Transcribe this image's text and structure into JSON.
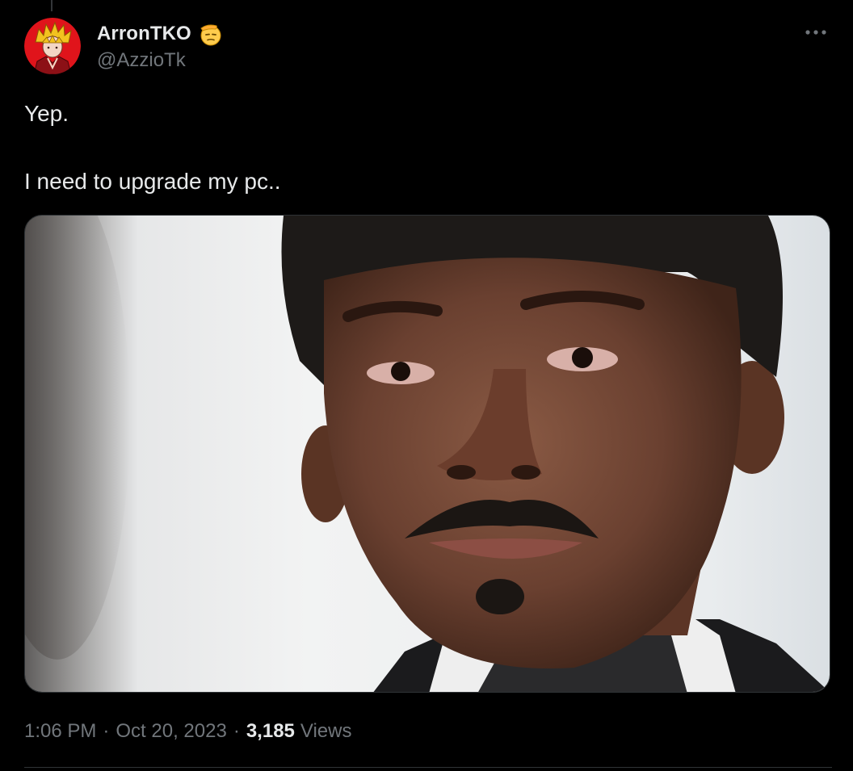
{
  "tweet": {
    "author": {
      "display_name": "ArronTKO",
      "handle": "@AzzioTk",
      "name_emoji": "saluting-face-emoji"
    },
    "more_icon": "more-horizontal-icon",
    "text_lines": [
      "Yep.",
      "I need to upgrade my pc.."
    ],
    "media": {
      "type": "photo"
    },
    "timestamp": {
      "time": "1:06 PM",
      "separator": "·",
      "date": "Oct 20, 2023"
    },
    "views": {
      "count": "3,185",
      "label": "Views"
    }
  },
  "colors": {
    "background": "#000000",
    "primary_text": "#e7e9ea",
    "secondary_text": "#71767b",
    "border": "#2f3336",
    "avatar_background": "#e0141b"
  }
}
